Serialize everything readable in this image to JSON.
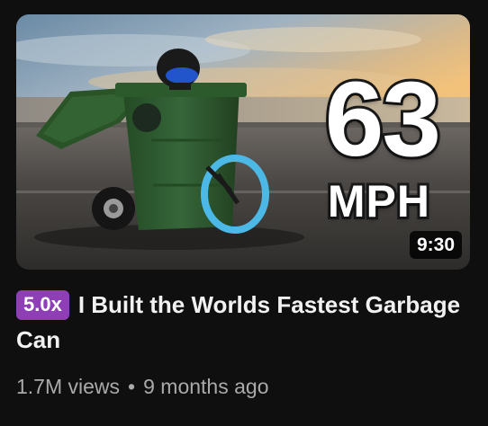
{
  "video": {
    "thumbnail": {
      "speed_number": "63",
      "speed_unit": "MPH",
      "duration": "9:30"
    },
    "speed_badge": "5.0x",
    "title": "I Built the Worlds Fastest Garbage Can",
    "views": "1.7M views",
    "separator": "•",
    "age": "9 months ago"
  },
  "colors": {
    "background": "#0f0f0f",
    "badge": "#8e3fb6",
    "title": "#f1f1f1",
    "secondary_text": "#aaaaaa",
    "garbage_can": "#2f5a2e",
    "wheel_ring": "#4cb8e6"
  }
}
